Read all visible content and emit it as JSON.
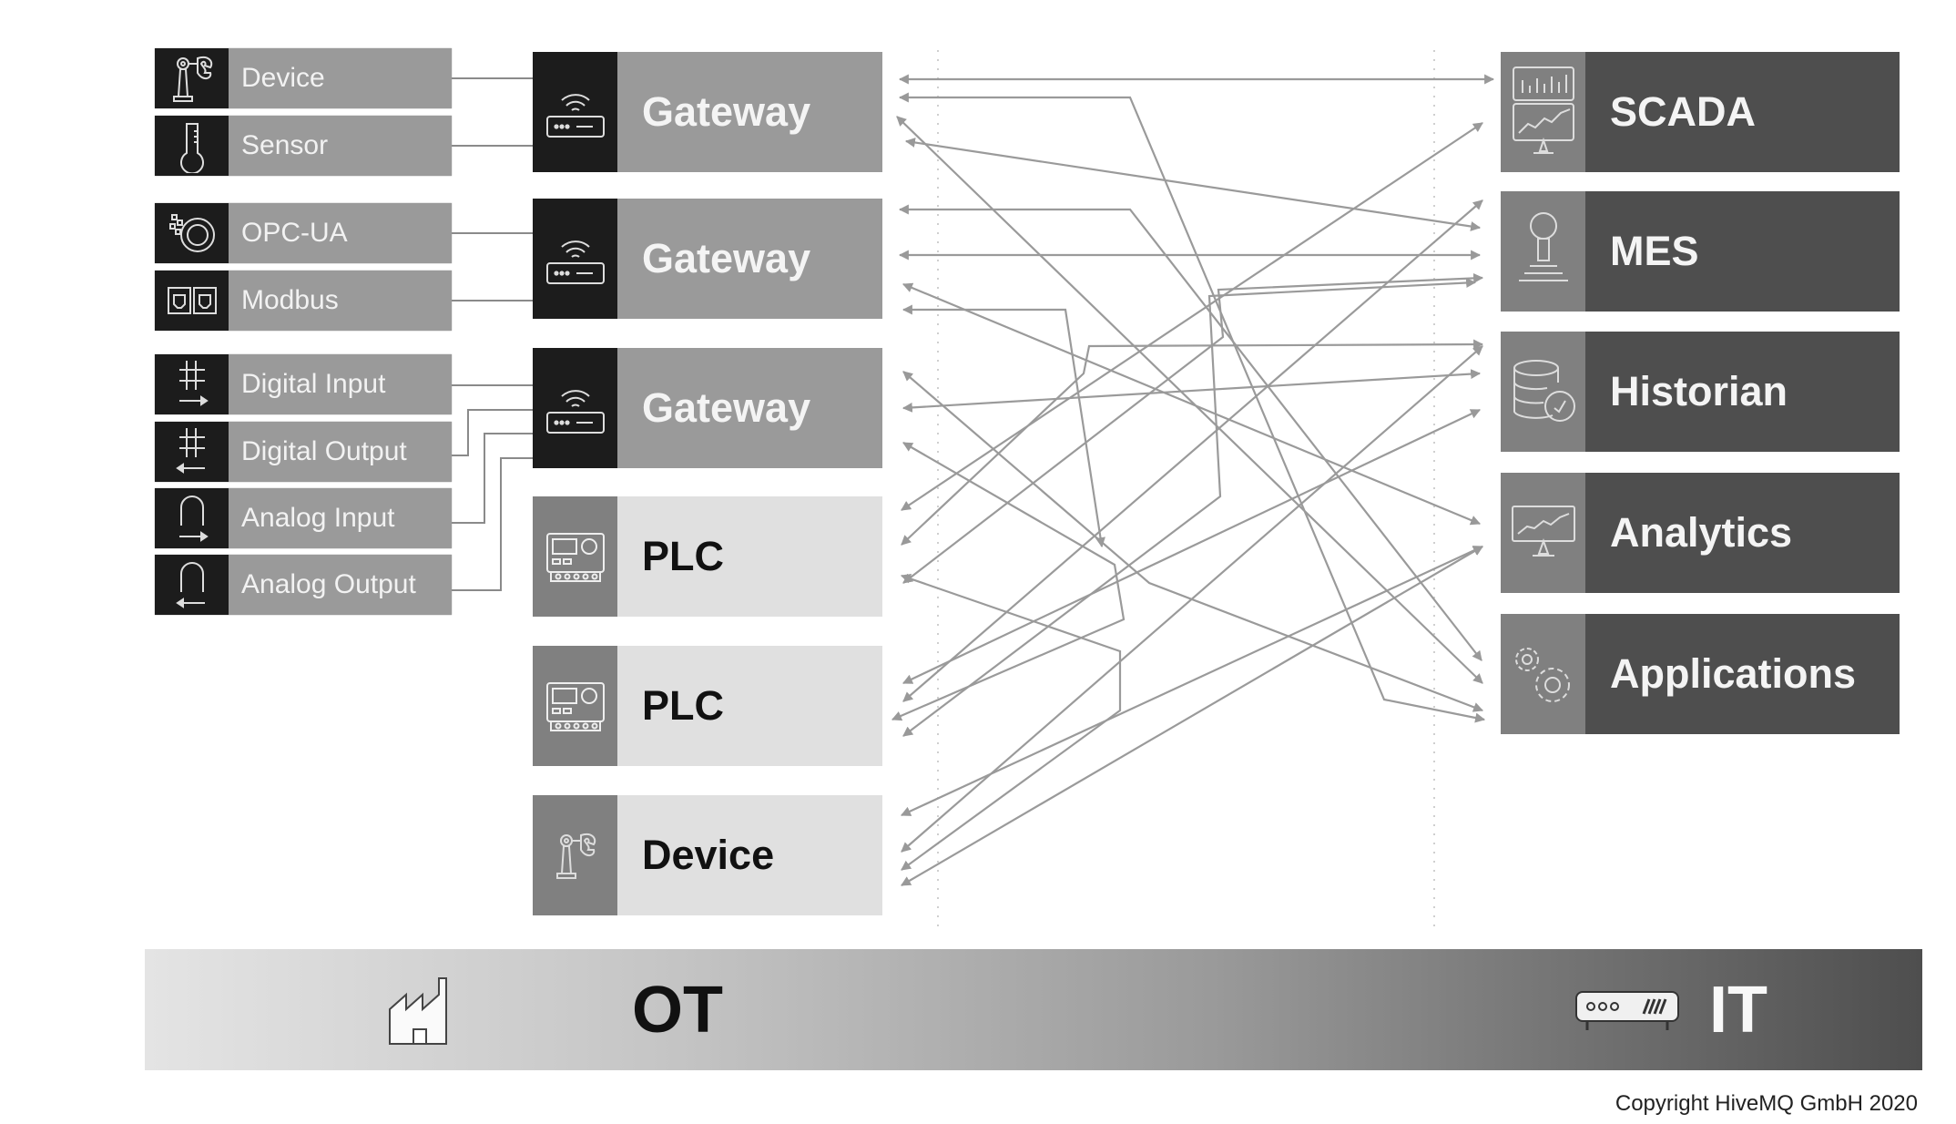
{
  "sources": [
    {
      "label": "Device",
      "icon": "robot-arm-icon"
    },
    {
      "label": "Sensor",
      "icon": "thermometer-icon"
    },
    {
      "label": "OPC-UA",
      "icon": "opc-ua-icon"
    },
    {
      "label": "Modbus",
      "icon": "ethernet-ports-icon"
    },
    {
      "label": "Digital Input",
      "icon": "digital-input-icon"
    },
    {
      "label": "Digital Output",
      "icon": "digital-output-icon"
    },
    {
      "label": "Analog Input",
      "icon": "analog-input-icon"
    },
    {
      "label": "Analog Output",
      "icon": "analog-output-icon"
    }
  ],
  "ot_nodes": [
    {
      "label": "Gateway",
      "icon": "router-icon"
    },
    {
      "label": "Gateway",
      "icon": "router-icon"
    },
    {
      "label": "Gateway",
      "icon": "router-icon"
    },
    {
      "label": "PLC",
      "icon": "plc-icon"
    },
    {
      "label": "PLC",
      "icon": "plc-icon"
    },
    {
      "label": "Device",
      "icon": "robot-arm-icon"
    }
  ],
  "it_nodes": [
    {
      "label": "SCADA",
      "icon": "dashboard-monitor-icon"
    },
    {
      "label": "MES",
      "icon": "joystick-icon"
    },
    {
      "label": "Historian",
      "icon": "database-clock-icon"
    },
    {
      "label": "Analytics",
      "icon": "chart-monitor-icon"
    },
    {
      "label": "Applications",
      "icon": "gears-icon"
    }
  ],
  "banner": {
    "left_label": "OT",
    "right_label": "IT",
    "left_icon": "factory-icon",
    "right_icon": "server-icon"
  },
  "copyright": "Copyright HiveMQ GmbH 2020",
  "colors": {
    "line": "#9a9a9a",
    "dark": "#1c1c1c",
    "it_box": "#4e4e4e",
    "gateway": "#9a9a9a",
    "plc": "#e0e0e0"
  }
}
